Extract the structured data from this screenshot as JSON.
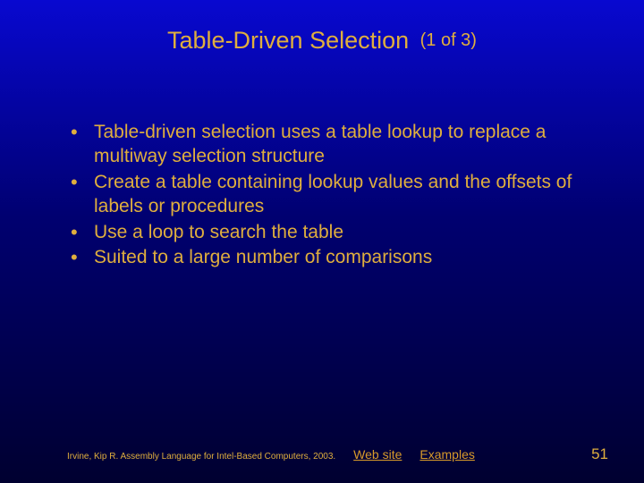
{
  "title": {
    "main": "Table-Driven Selection",
    "counter": "(1 of 3)"
  },
  "bullets": [
    "Table-driven selection uses a table lookup to replace a multiway selection structure",
    "Create a table containing lookup values and the offsets of labels or procedures",
    "Use a loop to search the table",
    "Suited to a large number of comparisons"
  ],
  "footer": {
    "citation": "Irvine, Kip R. Assembly Language for Intel-Based Computers, 2003.",
    "link_web": "Web site",
    "link_examples": "Examples",
    "page": "51"
  }
}
